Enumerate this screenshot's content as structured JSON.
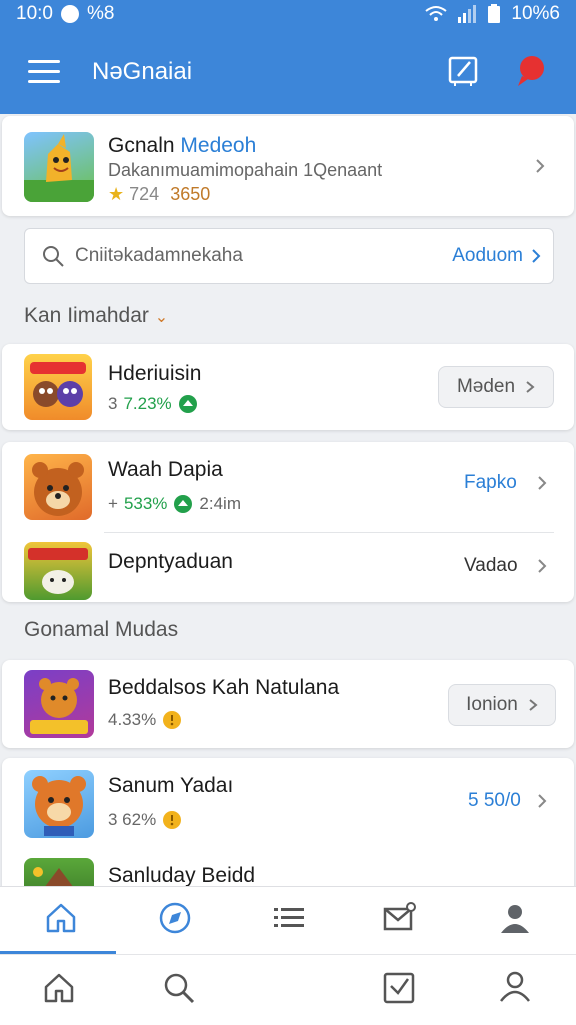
{
  "status": {
    "time": "10:0",
    "extra": "%8",
    "battery": "10%6"
  },
  "appbar": {
    "title": "NəGnaiai"
  },
  "featured": {
    "name_part1": "Gcnaln",
    "name_part2": "Medeoh",
    "subtitle": "Dakanımuamimopahain 1Qenaant",
    "rating": "724",
    "count": "3650"
  },
  "search": {
    "placeholder": "Cniitəkadamnekaha",
    "action": "Aoduom"
  },
  "section1": {
    "title": "Kan Iimahdar"
  },
  "items": [
    {
      "name": "Hderiuisin",
      "meta_prefix": "3",
      "meta": "7.23%",
      "action": "Məden",
      "action_style": "pill"
    },
    {
      "name": "Waah Dapia",
      "meta_prefix": "+",
      "meta": "533%",
      "meta_suffix": "2:4im",
      "action": "Fapko",
      "action_style": "blue"
    },
    {
      "name": "Depntyaduan",
      "meta_prefix": "",
      "meta": "",
      "action": "Vadao",
      "action_style": "plain"
    }
  ],
  "section2": {
    "title": "Gonamal Mudas"
  },
  "items2": [
    {
      "name": "Beddalsos Kah Natulana",
      "meta": "4.33%",
      "action": "Ionion",
      "action_style": "pill"
    },
    {
      "name": "Sanum Yadaı",
      "meta": "3 62%",
      "action": "5 50/0",
      "action_style": "blue"
    },
    {
      "name": "Sanluday Beidd",
      "meta": "",
      "action": "",
      "action_style": "blue"
    }
  ],
  "colors": {
    "primary": "#3d86d9",
    "green": "#22a04b",
    "accent_red": "#e63131"
  },
  "nav_top": [
    "home-icon",
    "compass-icon",
    "list-icon",
    "mail-icon",
    "profile-icon"
  ],
  "nav_bottom": [
    "home-icon",
    "search-icon",
    "checkbox-icon",
    "profile-icon"
  ]
}
